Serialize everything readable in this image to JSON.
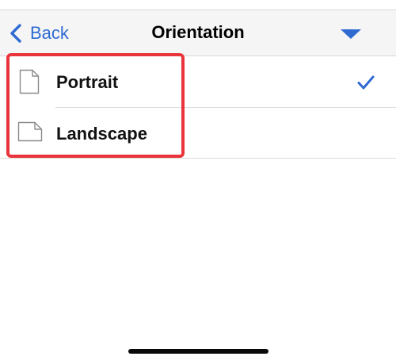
{
  "navbar": {
    "back_label": "Back",
    "title": "Orientation",
    "back_icon": "chevron-left-icon",
    "dropdown_icon": "triangle-down-icon"
  },
  "options": [
    {
      "label": "Portrait",
      "icon": "portrait-page-icon",
      "selected": true
    },
    {
      "label": "Landscape",
      "icon": "landscape-page-icon",
      "selected": false
    }
  ],
  "colors": {
    "accent": "#2f6bd1",
    "highlight": "#e8343a"
  }
}
